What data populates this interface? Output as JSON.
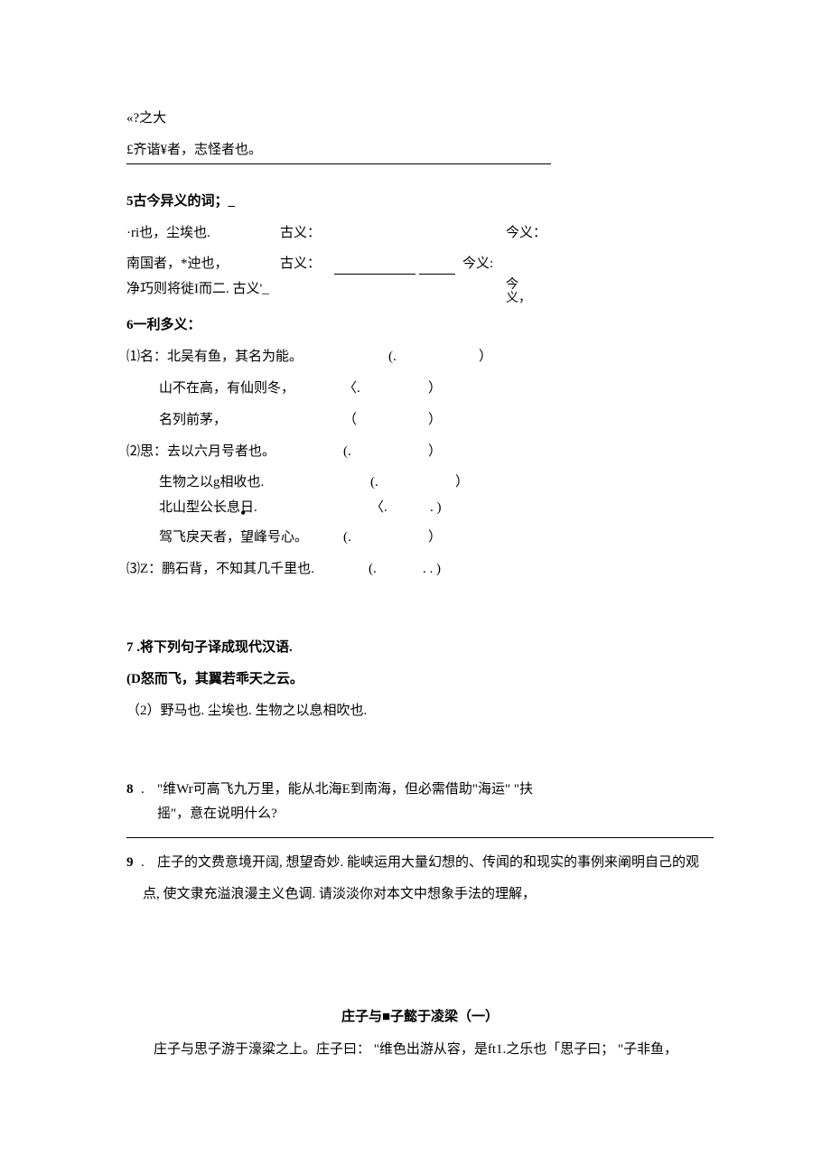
{
  "l1": "«?之大",
  "l2": "£齐谐¥者，志怪者也。",
  "q5": {
    "title": "5古今异义的词；_",
    "r1a": "·ri也，尘埃也.",
    "r1b": "古义：",
    "r1c": "今义：",
    "r2a": "南国者，*迚也，",
    "r2b": "古义：",
    "r2c": "今义:",
    "r3a": "净巧则将徙I而二. 古义'_",
    "r3b_top": "今",
    "r3b_bot": "义，"
  },
  "q6": {
    "title": "6一利多义：",
    "g1": {
      "head": "⑴名：北吴有鱼，其名为能。",
      "a": "山不在高，有仙则冬，",
      "b": "名列前茅，"
    },
    "g2": {
      "head": "⑵思：去以六月号者也。",
      "a": "生物之以g相收也.",
      "b": "北山型公长息日.",
      "c": "驾飞戾天者，望峰号心。"
    },
    "g3": {
      "head": "⑶Z：鹏石背，不知其几千里也."
    },
    "pL": "(.",
    "pLang": "〈.",
    "pLround": "（",
    "pR": "）",
    "pRdot": ". )",
    "pRdd": ". . )"
  },
  "q7": {
    "title": "7 .将下列句子译成现代汉语.",
    "a": "(D怒而飞，其翼若乖天之云。",
    "b": "（2）野马也. 尘埃也. 生物之以息相吹也."
  },
  "q8": {
    "num": "8",
    "dot": " . ",
    "text1": "\"维Wr可高飞九万里，能从北海E到南海，但必需借助\"海运\" \"扶",
    "text2": "摇\"，意在说明什么?"
  },
  "q9": {
    "num": "9",
    "dot": " . ",
    "text1": "庄子的文费意境开阔, 想望奇妙. 能峡运用大量幻想的、传闻的和现实的事例来阐明自己的观",
    "text2": "点, 使文隶充溢浪漫主义色调. 请淡淡你对本文中想象手法的理解，"
  },
  "title2": "庄子与■子懿于凌梁（一）",
  "para2": "庄子与思子游于濠粱之上。庄子曰： \"维色出游从容，是ft1.之乐也「思子曰； \"子非鱼，"
}
